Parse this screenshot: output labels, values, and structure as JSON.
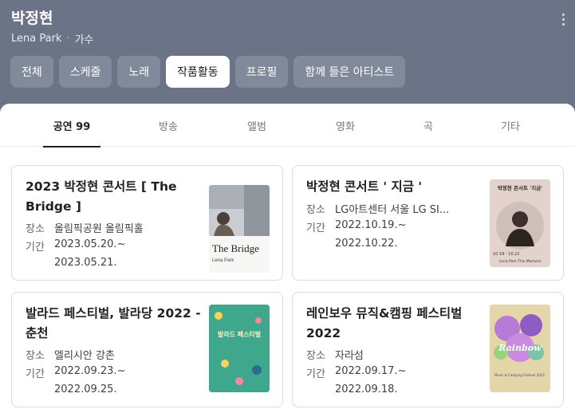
{
  "artist": {
    "name": "박정현",
    "english_name": "Lena Park",
    "role": "가수"
  },
  "chips": [
    "전체",
    "스케줄",
    "노래",
    "작품활동",
    "프로필",
    "함께 들은 아티스트"
  ],
  "active_chip": "작품활동",
  "subtabs": [
    "공연 99",
    "방송",
    "앨범",
    "영화",
    "곡",
    "기타"
  ],
  "active_subtab": "공연 99",
  "labels": {
    "venue": "장소",
    "period": "기간"
  },
  "cards": [
    {
      "title": "2023 박정현 콘서트 [ The Bridge ]",
      "venue": "올림픽공원 올림픽홀",
      "start": "2023.05.20.~",
      "end": "2023.05.21.",
      "poster_text": "The Bridge",
      "poster_sub": "Lena Park"
    },
    {
      "title": "박정현 콘서트 ' 지금 '",
      "venue": "LG아트센터 서울 LG SI...",
      "start": "2022.10.19.~",
      "end": "2022.10.22.",
      "poster_text": "박정현 콘서트 '지금'",
      "poster_sub": "Lena Park This Moment",
      "poster_dates": "10.19 - 10.22"
    },
    {
      "title": "발라드 페스티벌, 발라당 2022 - 춘천",
      "venue": "엘리시안 강촌",
      "start": "2022.09.23.~",
      "end": "2022.09.25.",
      "poster_text": "발라드 페스티벌"
    },
    {
      "title": "레인보우 뮤직&캠핑 페스티벌 2022",
      "venue": "자라섬",
      "start": "2022.09.17.~",
      "end": "2022.09.18.",
      "poster_text": "Rainbow",
      "poster_sub": "Music & Camping Festival 2022"
    }
  ],
  "colors": {
    "header_bg": "#6b7487",
    "chip_bg": "#818a9b",
    "active_chip_bg": "#ffffff"
  }
}
